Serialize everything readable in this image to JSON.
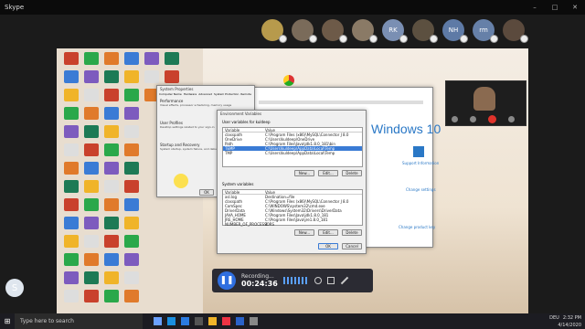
{
  "app": {
    "title": "Skype",
    "window_controls": [
      "–",
      "□",
      "✕"
    ]
  },
  "participants": [
    {
      "initials": "",
      "color": "#b79a4c"
    },
    {
      "initials": "",
      "color": "#7a6b5a"
    },
    {
      "initials": "",
      "color": "#6d5a48"
    },
    {
      "initials": "",
      "color": "#8a7a66"
    },
    {
      "initials": "RK",
      "color": "#7a8fb3"
    },
    {
      "initials": "",
      "color": "#5c5040"
    },
    {
      "initials": "NH",
      "color": "#5e7aa6"
    },
    {
      "initials": "rm",
      "color": "#6680a8"
    },
    {
      "initials": "",
      "color": "#5b4a3d"
    }
  ],
  "system_properties": {
    "title": "System Properties",
    "tabs": [
      "Computer Name",
      "Hardware",
      "Advanced",
      "System Protection",
      "Remote"
    ],
    "section1": "Performance",
    "section1_text": "Visual effects, processor scheduling, memory usage",
    "section2": "User Profiles",
    "section2_text": "Desktop settings related to your sign-in",
    "section3": "Startup and Recovery",
    "section3_text": "System startup, system failure, and debugging information",
    "ok": "OK"
  },
  "env_vars": {
    "title": "Environment Variables",
    "user_header": "User variables for kuldeep",
    "col_variable": "Variable",
    "col_value": "Value",
    "user_rows": [
      {
        "var": "classpath",
        "val": "C:\\Program Files (x86)\\MySQL\\Connector J 8.0"
      },
      {
        "var": "OneDrive",
        "val": "C:\\Users\\kuldeep\\OneDrive"
      },
      {
        "var": "Path",
        "val": "C:\\Program Files\\Java\\jdk1.8.0_181\\bin"
      },
      {
        "var": "TEMP",
        "val": "C:\\Users\\kuldeep\\AppData\\Local\\Temp",
        "selected": true
      },
      {
        "var": "TMP",
        "val": "C:\\Users\\kuldeep\\AppData\\Local\\Temp"
      }
    ],
    "sys_header": "System variables",
    "sys_rows": [
      {
        "var": "asl.log",
        "val": "Destination=file"
      },
      {
        "var": "classpath",
        "val": "C:\\Program Files (x86)\\MySQL\\Connector J 8.0"
      },
      {
        "var": "ComSpec",
        "val": "C:\\WINDOWS\\system32\\cmd.exe"
      },
      {
        "var": "DriverData",
        "val": "C:\\Windows\\System32\\Drivers\\DriverData"
      },
      {
        "var": "JAVA_HOME",
        "val": "C:\\Program Files\\Java\\jdk1.8.0_181"
      },
      {
        "var": "JRE_HOME",
        "val": "C:\\Program Files\\Java\\jre1.8.0_181"
      },
      {
        "var": "NUMBER_OF_PROCESSORS",
        "val": "4"
      }
    ],
    "new": "New...",
    "edit": "Edit...",
    "delete": "Delete",
    "ok": "OK",
    "cancel": "Cancel"
  },
  "windows_brand": "Windows 10",
  "support_info": "Support Information",
  "change_settings": "Change settings",
  "change_key": "Change product key",
  "recording": {
    "label": "Recording...",
    "time": "00:24:36"
  },
  "taskbar": {
    "search": "Type here to search",
    "lang": "DEU",
    "time": "2:32 PM",
    "date": "4/14/2020"
  }
}
